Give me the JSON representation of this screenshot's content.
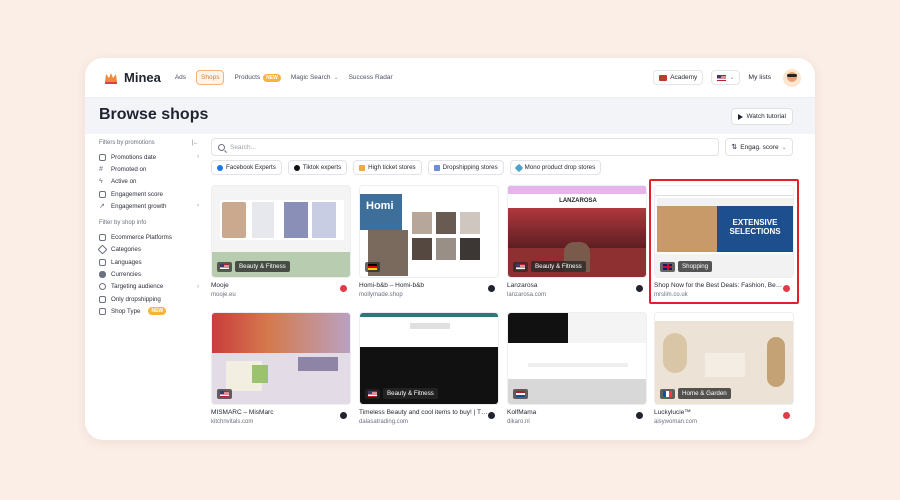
{
  "app": {
    "name": "Minea"
  },
  "nav": {
    "items": [
      {
        "label": "Ads"
      },
      {
        "label": "Shops",
        "active": true
      },
      {
        "label": "Products",
        "badge": "NEW"
      },
      {
        "label": "Magic Search",
        "dropdown": true
      },
      {
        "label": "Success Radar"
      }
    ],
    "academy": "Academy",
    "language_flag": "us-flag-icon",
    "my_lists": "My lists"
  },
  "header": {
    "title": "Browse shops",
    "watch_tutorial": "Watch tutorial"
  },
  "sidebar": {
    "promotions_heading": "Filters by promotions",
    "promotions": [
      {
        "label": "Promotions date",
        "icon": "calendar-icon",
        "chevron": true
      },
      {
        "label": "Promoted on",
        "icon": "hash-icon"
      },
      {
        "label": "Active on",
        "icon": "bolt-icon"
      },
      {
        "label": "Engagement score",
        "icon": "thumbs-up-icon"
      },
      {
        "label": "Engagement growth",
        "icon": "trend-icon",
        "chevron": true
      }
    ],
    "shop_info_heading": "Filter by shop info",
    "shop_info": [
      {
        "label": "Ecommerce Platforms",
        "icon": "cart-icon"
      },
      {
        "label": "Categories",
        "icon": "tag-icon"
      },
      {
        "label": "Languages",
        "icon": "language-icon"
      },
      {
        "label": "Currencies",
        "icon": "money-icon"
      },
      {
        "label": "Targeting audience",
        "icon": "target-icon",
        "chevron": true
      },
      {
        "label": "Only dropshipping",
        "icon": "box-icon"
      },
      {
        "label": "Shop Type",
        "icon": "store-icon",
        "badge": "NEW"
      }
    ]
  },
  "search": {
    "placeholder": "Search...",
    "sort_label": "Engag. score"
  },
  "chips": [
    {
      "label": "Facebook Experts",
      "color": "#1877f2"
    },
    {
      "label": "Tiktok experts",
      "color": "#111111"
    },
    {
      "label": "High ticket stores",
      "color": "#f2a93b"
    },
    {
      "label": "Dropshipping stores",
      "color": "#6b8fd6"
    },
    {
      "label": "Mono product drop stores",
      "color": "#4aa3c9"
    }
  ],
  "shops": [
    {
      "name": "Mooje",
      "url": "mooje.eu",
      "category": "Beauty & Fitness",
      "flag": "us",
      "platform": "pinterest"
    },
    {
      "name": "Homi-b&b – Homi-b&b",
      "url": "mollymade.shop",
      "category": "",
      "flag": "de",
      "platform": "shopify"
    },
    {
      "name": "Lanzarosa",
      "url": "lanzarosa.com",
      "category": "Beauty & Fitness",
      "flag": "us",
      "platform": "shopify"
    },
    {
      "name": "Shop Now for the Best Deals: Fashion, Beauty,...",
      "url": "mrslim.co.uk",
      "category": "Shopping",
      "flag": "uk",
      "platform": "pinterest",
      "highlighted": true
    },
    {
      "name": "MISMARC – MisMarc",
      "url": "kitchnvitals.com",
      "category": "",
      "flag": "us",
      "platform": "shopify"
    },
    {
      "name": "Timeless Beauty and cool items to buy! | The ...",
      "url": "dalasatrading.com",
      "category": "Beauty & Fitness",
      "flag": "us",
      "platform": "shopify"
    },
    {
      "name": "KolfMama",
      "url": "dikaro.nl",
      "category": "",
      "flag": "nl",
      "platform": "shopify"
    },
    {
      "name": "Luckylucie™",
      "url": "aisywoman.com",
      "category": "Home & Garden",
      "flag": "fr",
      "platform": "pinterest"
    }
  ],
  "thumb_text": {
    "homi": "Homi",
    "lanzarosa": "LANZAROSA",
    "extensive": "EXTENSIVE",
    "selections": "SELECTIONS"
  }
}
